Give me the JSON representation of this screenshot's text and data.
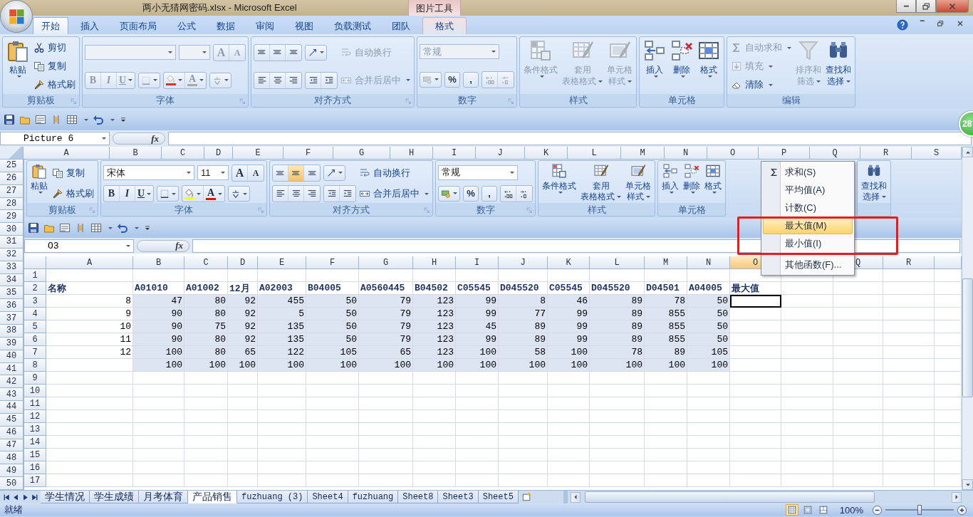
{
  "title_bar": {
    "title": "两小无猜网密码.xlsx - Microsoft Excel",
    "context_label": "图片工具"
  },
  "tabs": [
    {
      "label": "开始",
      "selected": true,
      "kind": "normal"
    },
    {
      "label": "插入",
      "selected": false,
      "kind": "normal"
    },
    {
      "label": "页面布局",
      "selected": false,
      "kind": "normal"
    },
    {
      "label": "公式",
      "selected": false,
      "kind": "normal"
    },
    {
      "label": "数据",
      "selected": false,
      "kind": "normal"
    },
    {
      "label": "审阅",
      "selected": false,
      "kind": "normal"
    },
    {
      "label": "视图",
      "selected": false,
      "kind": "normal"
    },
    {
      "label": "负载测试",
      "selected": false,
      "kind": "normal"
    },
    {
      "label": "团队",
      "selected": false,
      "kind": "normal"
    },
    {
      "label": "格式",
      "selected": false,
      "kind": "context"
    }
  ],
  "ribbon": {
    "groups": [
      {
        "label": "剪贴板",
        "launcher": true,
        "columns": [
          {
            "kind": "paste",
            "lines": [
              "粘贴"
            ],
            "dropdown": true,
            "disabled": false
          },
          {
            "kind": "stack",
            "rows": [
              {
                "kind": "cut",
                "label": "剪切",
                "disabled": false
              },
              {
                "kind": "copy",
                "label": "复制",
                "disabled": false
              },
              {
                "kind": "brush",
                "label": "格式刷",
                "disabled": false
              }
            ]
          }
        ]
      },
      {
        "label": "字体",
        "launcher": true,
        "columns": [
          {
            "kind": "stack",
            "rows": [
              {
                "kind": "tools",
                "items": [
                  {
                    "kind": "font-box",
                    "disabled": true
                  },
                  {
                    "kind": "size-box",
                    "disabled": true
                  },
                  {
                    "kind": "cluster",
                    "disabled": true,
                    "tools": [
                      {
                        "kind": "grow-font",
                        "text": "A"
                      },
                      {
                        "kind": "shrink-font",
                        "text": "A"
                      }
                    ]
                  }
                ]
              },
              {
                "kind": "tools",
                "items": [
                  {
                    "kind": "cluster",
                    "disabled": true,
                    "tools": [
                      {
                        "kind": "bold",
                        "text": "B"
                      },
                      {
                        "kind": "italic",
                        "text": "I"
                      },
                      {
                        "kind": "underline",
                        "text": "U",
                        "dropdown": true
                      }
                    ]
                  },
                  {
                    "kind": "cluster",
                    "disabled": true,
                    "tools": [
                      {
                        "kind": "border",
                        "dropdown": true
                      }
                    ]
                  },
                  {
                    "kind": "cluster",
                    "disabled": true,
                    "tools": [
                      {
                        "kind": "fill-color",
                        "dropdown": true,
                        "color": "#e03030"
                      },
                      {
                        "kind": "font-color",
                        "text": "A",
                        "dropdown": true,
                        "color": "#a8a8a8"
                      }
                    ]
                  },
                  {
                    "kind": "cluster",
                    "disabled": true,
                    "tools": [
                      {
                        "kind": "phonetic",
                        "dropdown": true
                      }
                    ]
                  }
                ]
              }
            ]
          }
        ]
      },
      {
        "label": "对齐方式",
        "launcher": true,
        "columns": [
          {
            "kind": "stack",
            "rows": [
              {
                "kind": "tools",
                "items": [
                  {
                    "kind": "cluster",
                    "disabled": false,
                    "tools": [
                      {
                        "kind": "align-top",
                        "selected": false
                      },
                      {
                        "kind": "align-middle",
                        "selected": false
                      },
                      {
                        "kind": "align-bottom",
                        "selected": false
                      }
                    ]
                  },
                  {
                    "kind": "cluster",
                    "disabled": false,
                    "tools": [
                      {
                        "kind": "orientation",
                        "dropdown": true
                      }
                    ]
                  }
                ]
              },
              {
                "kind": "tools",
                "items": [
                  {
                    "kind": "cluster",
                    "disabled": false,
                    "tools": [
                      {
                        "kind": "align-left",
                        "selected": false
                      },
                      {
                        "kind": "align-center",
                        "selected": false
                      },
                      {
                        "kind": "align-right",
                        "selected": false
                      }
                    ]
                  },
                  {
                    "kind": "cluster",
                    "disabled": false,
                    "tools": [
                      {
                        "kind": "outdent"
                      },
                      {
                        "kind": "indent"
                      }
                    ]
                  }
                ]
              }
            ]
          },
          {
            "kind": "stack",
            "rows": [
              {
                "kind": "wrap",
                "label": "自动换行",
                "disabled": true
              },
              {
                "kind": "merge",
                "label": "合并后居中",
                "dropdown": true,
                "disabled": true
              }
            ]
          }
        ]
      },
      {
        "label": "数字",
        "launcher": true,
        "columns": [
          {
            "kind": "stack",
            "rows": [
              {
                "kind": "tools",
                "items": [
                  {
                    "kind": "format-box",
                    "value": "常规",
                    "disabled": true
                  }
                ]
              },
              {
                "kind": "tools",
                "items": [
                  {
                    "kind": "cluster",
                    "disabled": true,
                    "tools": [
                      {
                        "kind": "currency",
                        "dropdown": true
                      }
                    ]
                  },
                  {
                    "kind": "cluster",
                    "disabled": false,
                    "tools": [
                      {
                        "kind": "percent",
                        "text": "%"
                      }
                    ]
                  },
                  {
                    "kind": "cluster",
                    "disabled": false,
                    "tools": [
                      {
                        "kind": "comma",
                        "text": ","
                      }
                    ]
                  },
                  {
                    "kind": "cluster",
                    "disabled": true,
                    "tools": [
                      {
                        "kind": "decimal-increase"
                      },
                      {
                        "kind": "decimal-decrease"
                      }
                    ]
                  }
                ]
              }
            ]
          }
        ]
      },
      {
        "label": "样式",
        "launcher": false,
        "columns": [
          {
            "kind": "conditional",
            "lines": [
              "条件格式"
            ],
            "dropdown": true,
            "disabled": true
          },
          {
            "kind": "table-format",
            "lines": [
              "套用",
              "表格格式"
            ],
            "dropdown": true,
            "disabled": true
          },
          {
            "kind": "cell-style",
            "lines": [
              "单元格",
              "样式"
            ],
            "dropdown": true,
            "disabled": true
          }
        ]
      },
      {
        "label": "单元格",
        "launcher": false,
        "columns": [
          {
            "kind": "insert",
            "lines": [
              "插入"
            ],
            "dropdown": true,
            "disabled": false
          },
          {
            "kind": "delete",
            "lines": [
              "删除"
            ],
            "dropdown": true,
            "disabled": false
          },
          {
            "kind": "format",
            "lines": [
              "格式"
            ],
            "dropdown": true,
            "disabled": false
          }
        ]
      },
      {
        "label": "编辑",
        "launcher": false,
        "columns": [
          {
            "kind": "stack",
            "rows": [
              {
                "kind": "sum",
                "label": "自动求和",
                "dropdown": true,
                "disabled": true
              },
              {
                "kind": "fill-down",
                "label": "填充",
                "dropdown": true,
                "disabled": true
              },
              {
                "kind": "eraser",
                "label": "清除",
                "dropdown": true,
                "disabled": false
              }
            ]
          },
          {
            "kind": "sort",
            "lines": [
              "排序和",
              "筛选"
            ],
            "dropdown": true,
            "disabled": true
          },
          {
            "kind": "find",
            "lines": [
              "查找和",
              "选择"
            ],
            "dropdown": true,
            "disabled": false
          }
        ]
      }
    ]
  },
  "formula_bar": {
    "name_box": "Picture 6",
    "function_label": "fx"
  },
  "badge": "28",
  "column_headers": [
    "A",
    "B",
    "C",
    "D",
    "E",
    "F",
    "G",
    "H",
    "I",
    "J",
    "K",
    "L",
    "M",
    "N",
    "O",
    "P",
    "Q",
    "R",
    "S"
  ],
  "row_headers": [
    "25",
    "26",
    "27",
    "28",
    "29",
    "30",
    "31",
    "32",
    "33",
    "34",
    "35",
    "36",
    "37",
    "38",
    "39",
    "40",
    "41",
    "42",
    "43",
    "44",
    "45",
    "46",
    "47",
    "48",
    "49",
    "50"
  ],
  "picture": {
    "ribbon": {
      "groups": [
        {
          "label": "剪贴板",
          "launcher": true,
          "columns": [
            {
              "kind": "paste",
              "lines": [
                "粘贴"
              ],
              "dropdown": true,
              "disabled": false
            },
            {
              "kind": "stack",
              "rows": [
                {
                  "kind": "copy",
                  "label": "复制",
                  "disabled": false
                },
                {
                  "kind": "brush",
                  "label": "格式刷",
                  "disabled": false
                }
              ]
            }
          ]
        },
        {
          "label": "字体",
          "launcher": true,
          "columns": [
            {
              "kind": "stack",
              "rows": [
                {
                  "kind": "tools",
                  "items": [
                    {
                      "kind": "font-box",
                      "value": "宋体",
                      "disabled": false
                    },
                    {
                      "kind": "size-box",
                      "value": "11",
                      "disabled": false
                    },
                    {
                      "kind": "cluster",
                      "disabled": false,
                      "tools": [
                        {
                          "kind": "grow-font",
                          "text": "A"
                        },
                        {
                          "kind": "shrink-font",
                          "text": "A"
                        }
                      ]
                    }
                  ]
                },
                {
                  "kind": "tools",
                  "items": [
                    {
                      "kind": "cluster",
                      "disabled": false,
                      "tools": [
                        {
                          "kind": "bold",
                          "text": "B"
                        },
                        {
                          "kind": "italic",
                          "text": "I"
                        },
                        {
                          "kind": "underline",
                          "text": "U",
                          "dropdown": true
                        }
                      ]
                    },
                    {
                      "kind": "cluster",
                      "disabled": false,
                      "tools": [
                        {
                          "kind": "border",
                          "dropdown": true
                        }
                      ]
                    },
                    {
                      "kind": "cluster",
                      "disabled": false,
                      "tools": [
                        {
                          "kind": "fill-color",
                          "dropdown": true,
                          "color": "#ffff00"
                        },
                        {
                          "kind": "font-color",
                          "text": "A",
                          "dropdown": true,
                          "color": "#e01010"
                        }
                      ]
                    },
                    {
                      "kind": "cluster",
                      "disabled": false,
                      "tools": [
                        {
                          "kind": "phonetic",
                          "dropdown": true
                        }
                      ]
                    }
                  ]
                }
              ]
            }
          ]
        },
        {
          "label": "对齐方式",
          "launcher": true,
          "columns": [
            {
              "kind": "stack",
              "rows": [
                {
                  "kind": "tools",
                  "items": [
                    {
                      "kind": "cluster",
                      "disabled": false,
                      "tools": [
                        {
                          "kind": "align-top",
                          "selected": false
                        },
                        {
                          "kind": "align-middle",
                          "selected": true
                        },
                        {
                          "kind": "align-bottom",
                          "selected": false
                        }
                      ]
                    },
                    {
                      "kind": "cluster",
                      "disabled": false,
                      "tools": [
                        {
                          "kind": "orientation",
                          "dropdown": true
                        }
                      ]
                    }
                  ]
                },
                {
                  "kind": "tools",
                  "items": [
                    {
                      "kind": "cluster",
                      "disabled": false,
                      "tools": [
                        {
                          "kind": "align-left",
                          "selected": false
                        },
                        {
                          "kind": "align-center",
                          "selected": false
                        },
                        {
                          "kind": "align-right",
                          "selected": false
                        }
                      ]
                    },
                    {
                      "kind": "cluster",
                      "disabled": false,
                      "tools": [
                        {
                          "kind": "outdent"
                        },
                        {
                          "kind": "indent"
                        }
                      ]
                    }
                  ]
                }
              ]
            },
            {
              "kind": "stack",
              "rows": [
                {
                  "kind": "wrap",
                  "label": "自动换行",
                  "disabled": false
                },
                {
                  "kind": "merge",
                  "label": "合并后居中",
                  "dropdown": true,
                  "disabled": false
                }
              ]
            }
          ]
        },
        {
          "label": "数字",
          "launcher": true,
          "columns": [
            {
              "kind": "stack",
              "rows": [
                {
                  "kind": "tools",
                  "items": [
                    {
                      "kind": "format-box",
                      "value": "常规",
                      "disabled": false
                    }
                  ]
                },
                {
                  "kind": "tools",
                  "items": [
                    {
                      "kind": "cluster",
                      "disabled": false,
                      "tools": [
                        {
                          "kind": "currency",
                          "dropdown": true
                        }
                      ]
                    },
                    {
                      "kind": "cluster",
                      "disabled": false,
                      "tools": [
                        {
                          "kind": "percent",
                          "text": "%"
                        }
                      ]
                    },
                    {
                      "kind": "cluster",
                      "disabled": false,
                      "tools": [
                        {
                          "kind": "comma",
                          "text": ","
                        }
                      ]
                    },
                    {
                      "kind": "cluster",
                      "disabled": false,
                      "tools": [
                        {
                          "kind": "decimal-increase"
                        },
                        {
                          "kind": "decimal-decrease"
                        }
                      ]
                    }
                  ]
                }
              ]
            }
          ]
        },
        {
          "label": "样式",
          "launcher": false,
          "columns": [
            {
              "kind": "conditional",
              "lines": [
                "条件格式"
              ],
              "dropdown": true,
              "disabled": false
            },
            {
              "kind": "table-format",
              "lines": [
                "套用",
                "表格格式"
              ],
              "dropdown": true,
              "disabled": false
            },
            {
              "kind": "cell-style",
              "lines": [
                "单元格",
                "样式"
              ],
              "dropdown": true,
              "disabled": false
            }
          ]
        },
        {
          "label": "单元格",
          "launcher": false,
          "columns": [
            {
              "kind": "insert",
              "lines": [
                "插入"
              ],
              "dropdown": true,
              "disabled": false
            },
            {
              "kind": "delete",
              "lines": [
                "删除"
              ],
              "dropdown": true,
              "disabled": false
            },
            {
              "kind": "format",
              "lines": [
                "格式"
              ],
              "dropdown": true,
              "disabled": false
            }
          ]
        },
        {
          "launcher": false,
          "columns": [
            {
              "kind": "find",
              "lines": [
                "查找和",
                "选择"
              ],
              "dropdown": true,
              "disabled": false
            }
          ]
        }
      ]
    },
    "formula_bar": {
      "name_box": "O3",
      "function_label": "fx"
    },
    "sheet": {
      "columns": [
        {
          "label": "A",
          "highlighted": false
        },
        {
          "label": "B",
          "highlighted": false
        },
        {
          "label": "C",
          "highlighted": false
        },
        {
          "label": "D",
          "highlighted": false
        },
        {
          "label": "E",
          "highlighted": false
        },
        {
          "label": "F",
          "highlighted": false
        },
        {
          "label": "G",
          "highlighted": false
        },
        {
          "label": "H",
          "highlighted": false
        },
        {
          "label": "I",
          "highlighted": false
        },
        {
          "label": "J",
          "highlighted": false
        },
        {
          "label": "K",
          "highlighted": false
        },
        {
          "label": "L",
          "highlighted": false
        },
        {
          "label": "M",
          "highlighted": false
        },
        {
          "label": "N",
          "highlighted": false
        },
        {
          "label": "O",
          "highlighted": true
        },
        {},
        {
          "label": "Q",
          "highlighted": false
        },
        {
          "label": "R",
          "highlighted": false
        }
      ],
      "rows": [
        {
          "header": "1",
          "highlighted": false
        },
        {
          "header": "2",
          "highlighted": false,
          "kind": "header",
          "cells": [
            {
              "text": "名称"
            },
            {
              "text": "A01010"
            },
            {
              "text": "A01002"
            },
            {
              "text": "12月"
            },
            {
              "text": "A02003"
            },
            {
              "text": "B04005"
            },
            {
              "text": "A0560445"
            },
            {
              "text": "B04502"
            },
            {
              "text": "C05545"
            },
            {
              "text": "D045520"
            },
            {
              "text": "C05545"
            },
            {
              "text": "D045520"
            },
            {
              "text": "D04501"
            },
            {
              "text": "A04005"
            },
            {
              "text": "最大值"
            }
          ]
        },
        {
          "header": "3",
          "highlighted": false,
          "kind": "data",
          "cells": [
            {
              "text": "8",
              "selected": false
            },
            {
              "text": "47",
              "selected": true
            },
            {
              "text": "80",
              "selected": true
            },
            {
              "text": "92",
              "selected": true
            },
            {
              "text": "455",
              "selected": true
            },
            {
              "text": "50",
              "selected": true
            },
            {
              "text": "79",
              "selected": true
            },
            {
              "text": "123",
              "selected": true
            },
            {
              "text": "99",
              "selected": true
            },
            {
              "text": "8",
              "selected": true
            },
            {
              "text": "46",
              "selected": true
            },
            {
              "text": "89",
              "selected": true
            },
            {
              "text": "78",
              "selected": true
            },
            {
              "text": "50",
              "selected": true
            },
            {
              "active": true,
              "selected": false
            }
          ]
        },
        {
          "header": "4",
          "highlighted": false,
          "kind": "data",
          "cells": [
            {
              "text": "9",
              "selected": false
            },
            {
              "text": "90",
              "selected": true
            },
            {
              "text": "80",
              "selected": true
            },
            {
              "text": "92",
              "selected": true
            },
            {
              "text": "5",
              "selected": true
            },
            {
              "text": "50",
              "selected": true
            },
            {
              "text": "79",
              "selected": true
            },
            {
              "text": "123",
              "selected": true
            },
            {
              "text": "99",
              "selected": true
            },
            {
              "text": "77",
              "selected": true
            },
            {
              "text": "99",
              "selected": true
            },
            {
              "text": "89",
              "selected": true
            },
            {
              "text": "855",
              "selected": true
            },
            {
              "text": "50",
              "selected": true
            }
          ]
        },
        {
          "header": "5",
          "highlighted": false,
          "kind": "data",
          "cells": [
            {
              "text": "10",
              "selected": false
            },
            {
              "text": "90",
              "selected": true
            },
            {
              "text": "75",
              "selected": true
            },
            {
              "text": "92",
              "selected": true
            },
            {
              "text": "135",
              "selected": true
            },
            {
              "text": "50",
              "selected": true
            },
            {
              "text": "79",
              "selected": true
            },
            {
              "text": "123",
              "selected": true
            },
            {
              "text": "45",
              "selected": true
            },
            {
              "text": "89",
              "selected": true
            },
            {
              "text": "99",
              "selected": true
            },
            {
              "text": "89",
              "selected": true
            },
            {
              "text": "855",
              "selected": true
            },
            {
              "text": "50",
              "selected": true
            }
          ]
        },
        {
          "header": "6",
          "highlighted": false,
          "kind": "data",
          "cells": [
            {
              "text": "11",
              "selected": false
            },
            {
              "text": "90",
              "selected": true
            },
            {
              "text": "80",
              "selected": true
            },
            {
              "text": "92",
              "selected": true
            },
            {
              "text": "135",
              "selected": true
            },
            {
              "text": "50",
              "selected": true
            },
            {
              "text": "79",
              "selected": true
            },
            {
              "text": "123",
              "selected": true
            },
            {
              "text": "99",
              "selected": true
            },
            {
              "text": "89",
              "selected": true
            },
            {
              "text": "99",
              "selected": true
            },
            {
              "text": "89",
              "selected": true
            },
            {
              "text": "855",
              "selected": true
            },
            {
              "text": "50",
              "selected": true
            }
          ]
        },
        {
          "header": "7",
          "highlighted": false,
          "kind": "data",
          "cells": [
            {
              "text": "12",
              "selected": false
            },
            {
              "text": "100",
              "selected": true
            },
            {
              "text": "80",
              "selected": true
            },
            {
              "text": "65",
              "selected": true
            },
            {
              "text": "122",
              "selected": true
            },
            {
              "text": "105",
              "selected": true
            },
            {
              "text": "65",
              "selected": true
            },
            {
              "text": "123",
              "selected": true
            },
            {
              "text": "100",
              "selected": true
            },
            {
              "text": "58",
              "selected": true
            },
            {
              "text": "100",
              "selected": true
            },
            {
              "text": "78",
              "selected": true
            },
            {
              "text": "89",
              "selected": true
            },
            {
              "text": "105",
              "selected": true
            }
          ]
        },
        {
          "header": "8",
          "highlighted": false,
          "kind": "data",
          "cells": [
            {
              "selected": false
            },
            {
              "text": "100",
              "selected": true
            },
            {
              "text": "100",
              "selected": true
            },
            {
              "text": "100",
              "selected": true
            },
            {
              "text": "100",
              "selected": true
            },
            {
              "text": "100",
              "selected": true
            },
            {
              "text": "100",
              "selected": true
            },
            {
              "text": "100",
              "selected": true
            },
            {
              "text": "100",
              "selected": true
            },
            {
              "text": "100",
              "selected": true
            },
            {
              "text": "100",
              "selected": true
            },
            {
              "text": "100",
              "selected": true
            },
            {
              "text": "100",
              "selected": true
            },
            {
              "text": "100",
              "selected": true
            }
          ]
        },
        {
          "header": "9",
          "highlighted": false
        },
        {
          "header": "10",
          "highlighted": false
        },
        {
          "header": "11",
          "highlighted": false
        },
        {
          "header": "12",
          "highlighted": false
        },
        {
          "header": "13",
          "highlighted": false
        },
        {
          "header": "14",
          "highlighted": false
        },
        {
          "header": "15",
          "highlighted": false
        },
        {
          "header": "16",
          "highlighted": false
        },
        {
          "header": "17",
          "highlighted": false
        }
      ]
    },
    "menu": {
      "items": [
        {
          "kind": "sum",
          "label": "求和(S)",
          "selected": false
        },
        {
          "kind": "item",
          "label": "平均值(A)",
          "selected": false
        },
        {
          "kind": "item",
          "label": "计数(C)",
          "selected": false
        },
        {
          "kind": "item",
          "label": "最大值(M)",
          "selected": true
        },
        {
          "kind": "item",
          "label": "最小值(I)",
          "selected": false
        },
        {
          "kind": "item",
          "label": "其他函数(F)...",
          "selected": false,
          "divider": true
        }
      ]
    },
    "highlight_frame": true
  },
  "sheet_tabs": [
    {
      "label": "学生情况",
      "selected": false
    },
    {
      "label": "学生成绩",
      "selected": false
    },
    {
      "label": "月考体育",
      "selected": false
    },
    {
      "label": "产品销售",
      "selected": true
    },
    {
      "label": "fuzhuang (3)",
      "selected": false
    },
    {
      "label": "Sheet4",
      "selected": false
    },
    {
      "label": "fuzhuang",
      "selected": false
    },
    {
      "label": "Sheet8",
      "selected": false
    },
    {
      "label": "Sheet3",
      "selected": false
    },
    {
      "label": "Sheet5",
      "selected": false
    }
  ],
  "status_bar": {
    "status": "就绪",
    "views": [
      {
        "kind": "normal",
        "selected": true
      },
      {
        "kind": "page-layout",
        "selected": false
      },
      {
        "kind": "page-break",
        "selected": false
      }
    ],
    "zoom": "100%",
    "zoom_slider": {
      "level": 0.5
    }
  }
}
